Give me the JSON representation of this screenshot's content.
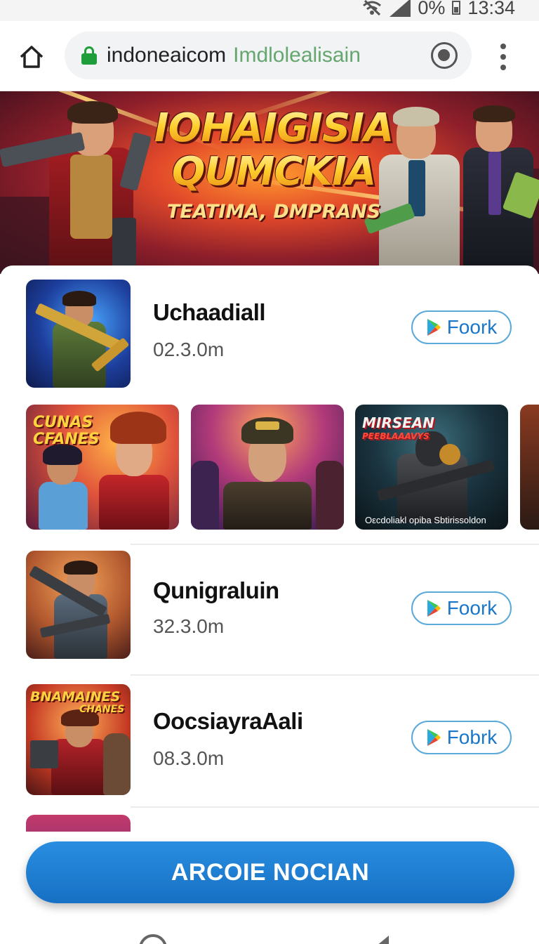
{
  "status_bar": {
    "battery_percent": "0%",
    "time": "13:34",
    "icons": [
      "wifi-off-icon",
      "signal-icon",
      "battery-icon"
    ]
  },
  "browser": {
    "url_host": "indoneaicom",
    "url_path": "Imdlolealisain",
    "icons": [
      "home-icon",
      "lock-icon",
      "record-icon",
      "more-vert-icon"
    ]
  },
  "banner": {
    "line1": "IOHAIGISIA",
    "line2": "QUMCKIA",
    "subtitle": "TEATIMA, DMPRANS"
  },
  "apps": [
    {
      "name": "Uchaadiall",
      "size": "02.3.0m",
      "button": "Foork"
    },
    {
      "name": "Qunigraluin",
      "size": "32.3.0m",
      "button": "Foork"
    },
    {
      "name": "OocsiayraAali",
      "size": "08.3.0m",
      "button": "Fobrk"
    }
  ],
  "carousel": {
    "shot1_title_line1": "CUNAS",
    "shot1_title_line2": "CFANES",
    "shot3_title_line1": "MIRSEAN",
    "shot3_title_line2": "PEEBLAAAVYS",
    "shot3_caption": "Oεcdoliakl opiba Sbtirissoldon"
  },
  "partial_icon_title": "BNAMAINES",
  "app3_icon_title_line1": "BNAMAINES",
  "app3_icon_title_line2": "CHANES",
  "cta": {
    "label": "ARCOIE NOCIAN"
  },
  "colors": {
    "accent": "#1670c4",
    "button_border": "#5aa9d8",
    "lock_green": "#1e9e3a",
    "banner_red": "#8e1f2a",
    "banner_gold": "#ffcf2e"
  }
}
